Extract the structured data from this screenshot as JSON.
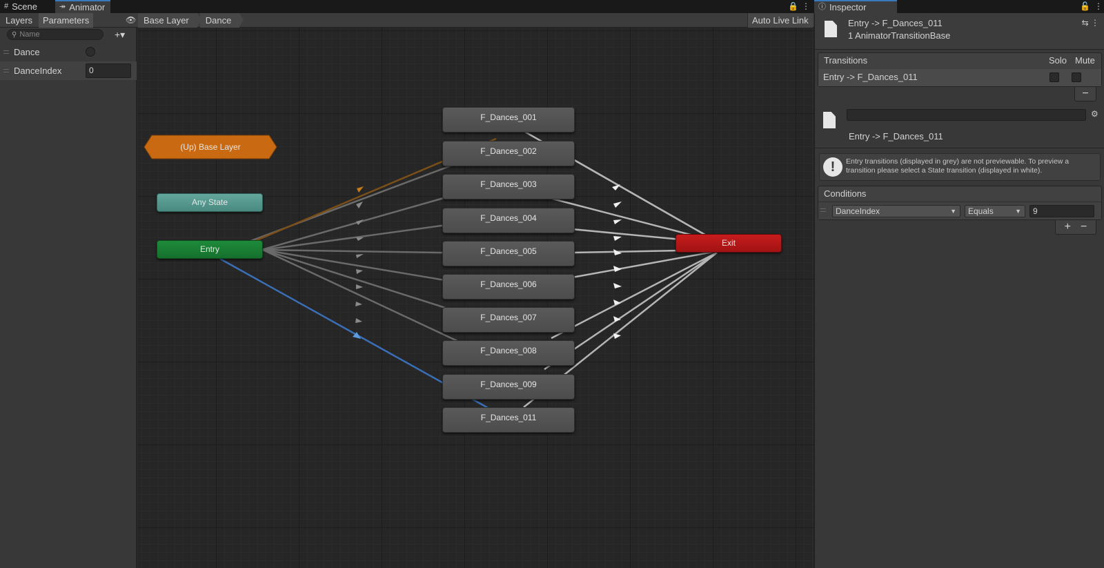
{
  "tabs": {
    "scene": "Scene",
    "animator": "Animator",
    "inspector": "Inspector"
  },
  "toolbar": {
    "layers": "Layers",
    "parameters": "Parameters",
    "auto_live_link": "Auto Live Link",
    "breadcrumbs": [
      "Base Layer",
      "Dance"
    ]
  },
  "parameters": {
    "search_placeholder": "Name",
    "items": [
      {
        "name": "Dance",
        "type": "trigger"
      },
      {
        "name": "DanceIndex",
        "type": "int",
        "value": "0"
      }
    ]
  },
  "graph": {
    "up_node": "(Up) Base Layer",
    "any_state": "Any State",
    "entry": "Entry",
    "exit": "Exit",
    "states": [
      "F_Dances_001",
      "F_Dances_002",
      "F_Dances_003",
      "F_Dances_004",
      "F_Dances_005",
      "F_Dances_006",
      "F_Dances_007",
      "F_Dances_008",
      "F_Dances_009",
      "F_Dances_011"
    ],
    "colors": {
      "up": "#c96a12",
      "any": "#5a9b90",
      "entry": "#1b7d34",
      "exit": "#b51717",
      "state": "#525252",
      "selected_transition": "#3a6fb5",
      "up_transition": "#8a5a1a"
    }
  },
  "inspector": {
    "title": "Entry -> F_Dances_011",
    "subtitle": "1 AnimatorTransitionBase",
    "transitions": {
      "header": "Transitions",
      "solo": "Solo",
      "mute": "Mute",
      "rows": [
        "Entry -> F_Dances_011"
      ],
      "remove": "−"
    },
    "transition_label": "Entry -> F_Dances_011",
    "help_text": "Entry transitions (displayed in grey) are not previewable. To preview a transition please select a State transition (displayed in white).",
    "conditions": {
      "header": "Conditions",
      "parameter": "DanceIndex",
      "mode": "Equals",
      "value": "9",
      "add": "+",
      "remove": "−"
    }
  }
}
